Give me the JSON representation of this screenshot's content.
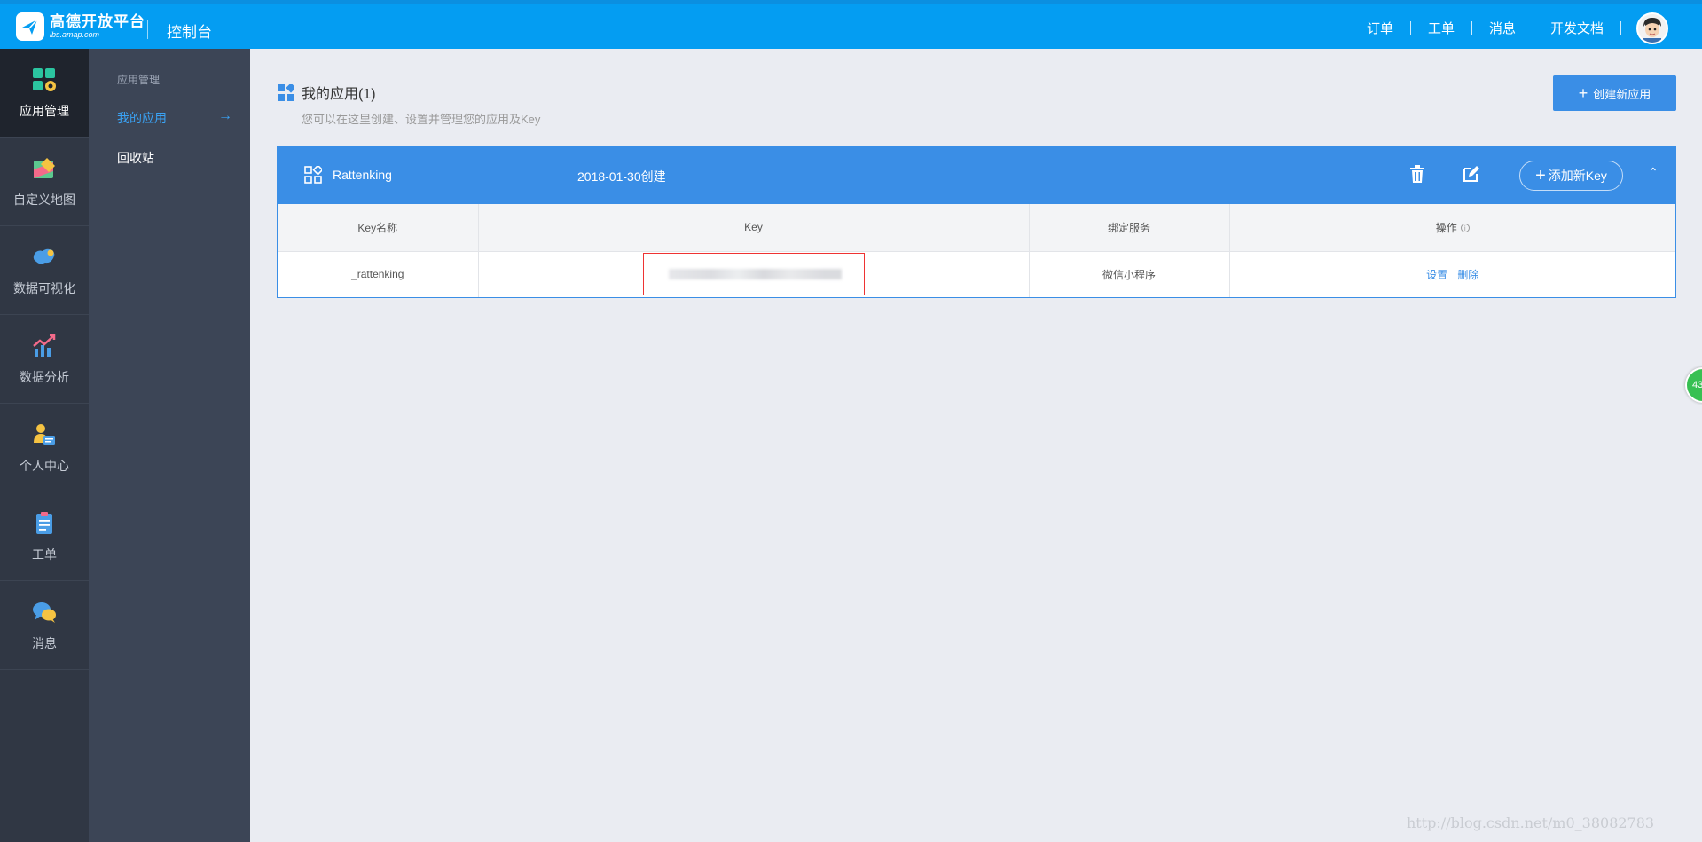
{
  "header": {
    "logo_name": "高德开放平台",
    "logo_url": "lbs.amap.com",
    "console": "控制台",
    "nav": [
      "订单",
      "工单",
      "消息",
      "开发文档"
    ]
  },
  "iconbar": {
    "items": [
      {
        "label": "应用管理",
        "icon": "app-grid-gear-icon",
        "active": true
      },
      {
        "label": "自定义地图",
        "icon": "custom-map-icon"
      },
      {
        "label": "数据可视化",
        "icon": "china-map-icon"
      },
      {
        "label": "数据分析",
        "icon": "trend-chart-icon"
      },
      {
        "label": "个人中心",
        "icon": "user-card-icon"
      },
      {
        "label": "工单",
        "icon": "clipboard-icon"
      },
      {
        "label": "消息",
        "icon": "chat-bubbles-icon"
      }
    ]
  },
  "subbar": {
    "section": "应用管理",
    "my_apps": "我的应用",
    "recycle": "回收站"
  },
  "main": {
    "title": "我的应用(1)",
    "subtitle": "您可以在这里创建、设置并管理您的应用及Key",
    "create_button": "创建新应用"
  },
  "app": {
    "name": "Rattenking",
    "created": "2018-01-30创建",
    "add_key": "添加新Key",
    "columns": [
      "Key名称",
      "Key",
      "绑定服务",
      "操作"
    ],
    "rows": [
      {
        "key_name": "_rattenking",
        "service": "微信小程序",
        "actions": [
          "设置",
          "删除"
        ]
      }
    ]
  },
  "watermark": "http://blog.csdn.net/m0_38082783",
  "float_badge": "43",
  "colors": {
    "topbar": "#049df2",
    "accent": "#3a8ee6",
    "sidebar": "#303744",
    "subbar": "#3c4556"
  }
}
